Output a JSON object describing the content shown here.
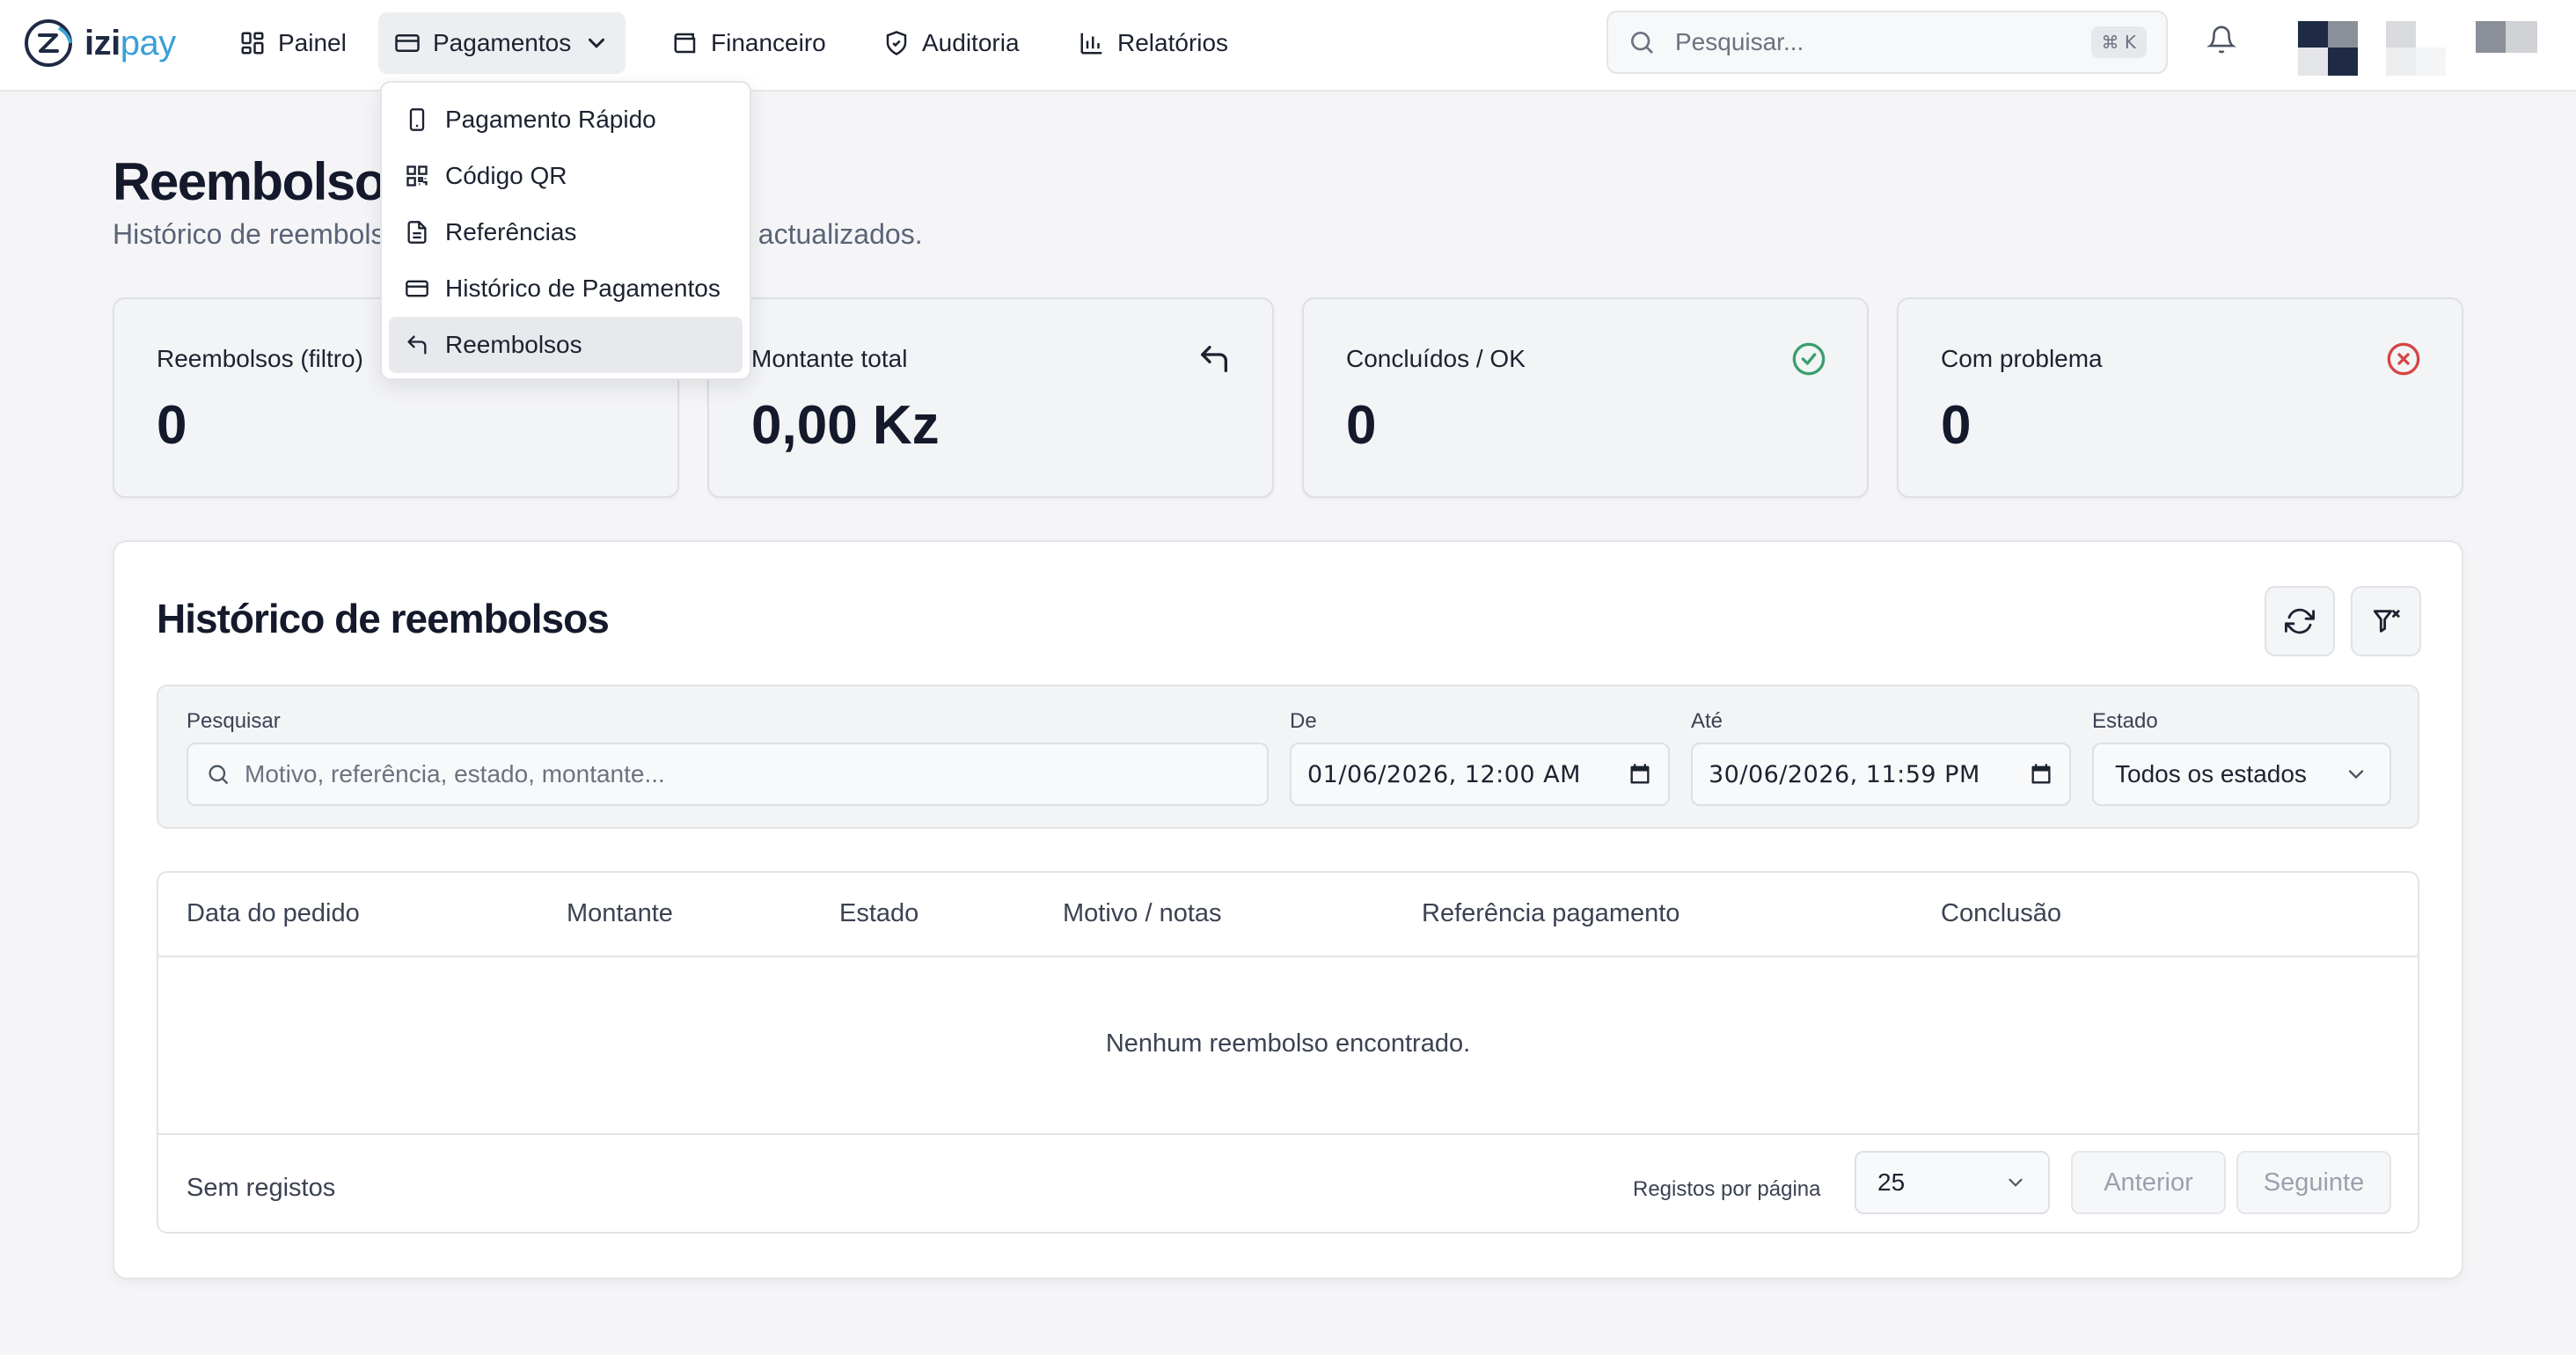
{
  "app": {
    "logo": {
      "izi": "izi",
      "pay": "pay"
    },
    "nav": [
      {
        "label": "Painel",
        "icon": "dashboard-icon"
      },
      {
        "label": "Pagamentos",
        "icon": "card-icon",
        "active": true
      },
      {
        "label": "Financeiro",
        "icon": "wallet-icon"
      },
      {
        "label": "Auditoria",
        "icon": "shield-icon"
      },
      {
        "label": "Relatórios",
        "icon": "bar-chart-icon"
      }
    ],
    "search": {
      "placeholder": "Pesquisar...",
      "shortcut": "⌘ K"
    }
  },
  "dropdown": {
    "items": [
      {
        "label": "Pagamento Rápido",
        "icon": "phone-icon"
      },
      {
        "label": "Código QR",
        "icon": "qr-code-icon"
      },
      {
        "label": "Referências",
        "icon": "document-icon"
      },
      {
        "label": "Histórico de Pagamentos",
        "icon": "card-icon"
      },
      {
        "label": "Reembolsos",
        "icon": "undo-icon",
        "active": true
      }
    ]
  },
  "page": {
    "title": "Reembolsos",
    "subtitle": "Histórico de reembolsos",
    "subtitle_tail": "a dos totais actualizados."
  },
  "stats": [
    {
      "label": "Reembolsos (filtro)",
      "value": "0"
    },
    {
      "label": "Montante total",
      "value": "0,00 Kz",
      "icon": "undo-icon"
    },
    {
      "label": "Concluídos / OK",
      "value": "0",
      "icon": "check-circle-icon",
      "color": "#3a9f6e"
    },
    {
      "label": "Com problema",
      "value": "0",
      "icon": "x-circle-icon",
      "color": "#d64545"
    }
  ],
  "history": {
    "title": "Histórico de reembolsos",
    "filters": {
      "search_label": "Pesquisar",
      "search_placeholder": "Motivo, referência, estado, montante...",
      "from_label": "De",
      "from_value": "01/06/2026, 12:00 AM",
      "to_label": "Até",
      "to_value": "30/06/2026, 11:59 PM",
      "status_label": "Estado",
      "status_value": "Todos os estados"
    },
    "columns": [
      "Data do pedido",
      "Montante",
      "Estado",
      "Motivo / notas",
      "Referência pagamento",
      "Conclusão"
    ],
    "empty_message": "Nenhum reembolso encontrado.",
    "footer": {
      "records": "Sem registos",
      "per_page_label": "Registos por página",
      "per_page_value": "25",
      "prev": "Anterior",
      "next": "Seguinte"
    }
  }
}
